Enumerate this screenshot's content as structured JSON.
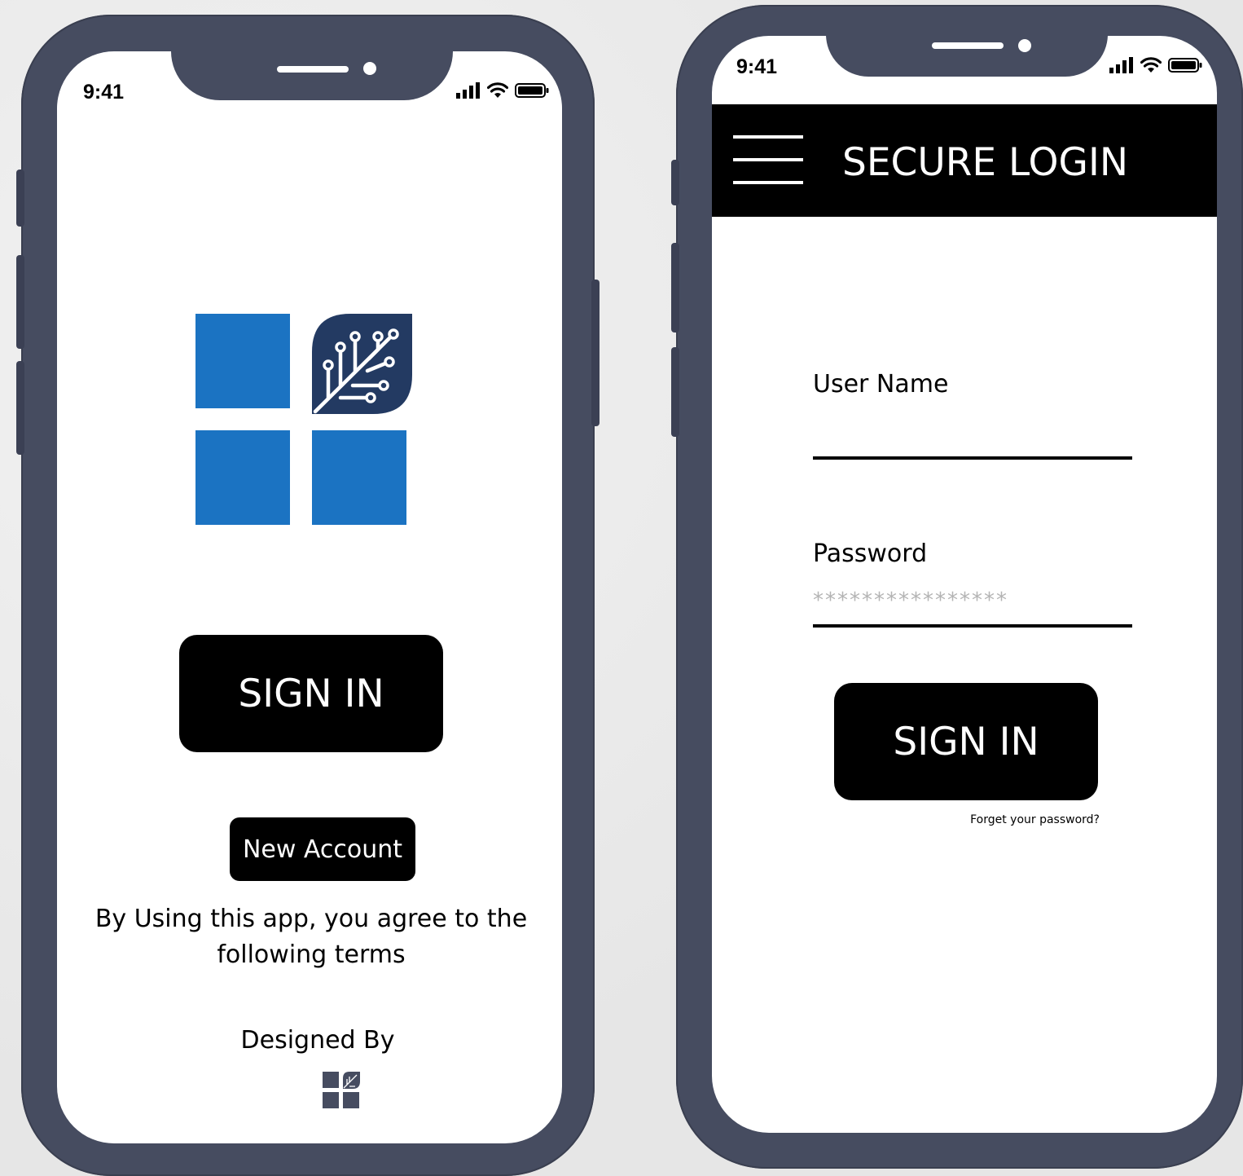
{
  "welcome_screen": {
    "status_time": "9:41",
    "sign_in_label": "SIGN IN",
    "new_account_label": "New Account",
    "terms_line1": "By Using this app, you agree to the",
    "terms_line2": "following terms",
    "designed_by_label": "Designed By",
    "logo_color": "#1b73c2",
    "leaf_color": "#233a62"
  },
  "login_screen": {
    "status_time": "9:41",
    "header_title": "SECURE LOGIN",
    "username_label": "User Name",
    "username_value": "",
    "password_label": "Password",
    "password_value": "****************",
    "sign_in_label": "SIGN IN",
    "forgot_password_label": "Forget your password?"
  },
  "colors": {
    "phone_frame": "#464c60",
    "button_bg": "#000000",
    "button_text": "#ffffff"
  }
}
